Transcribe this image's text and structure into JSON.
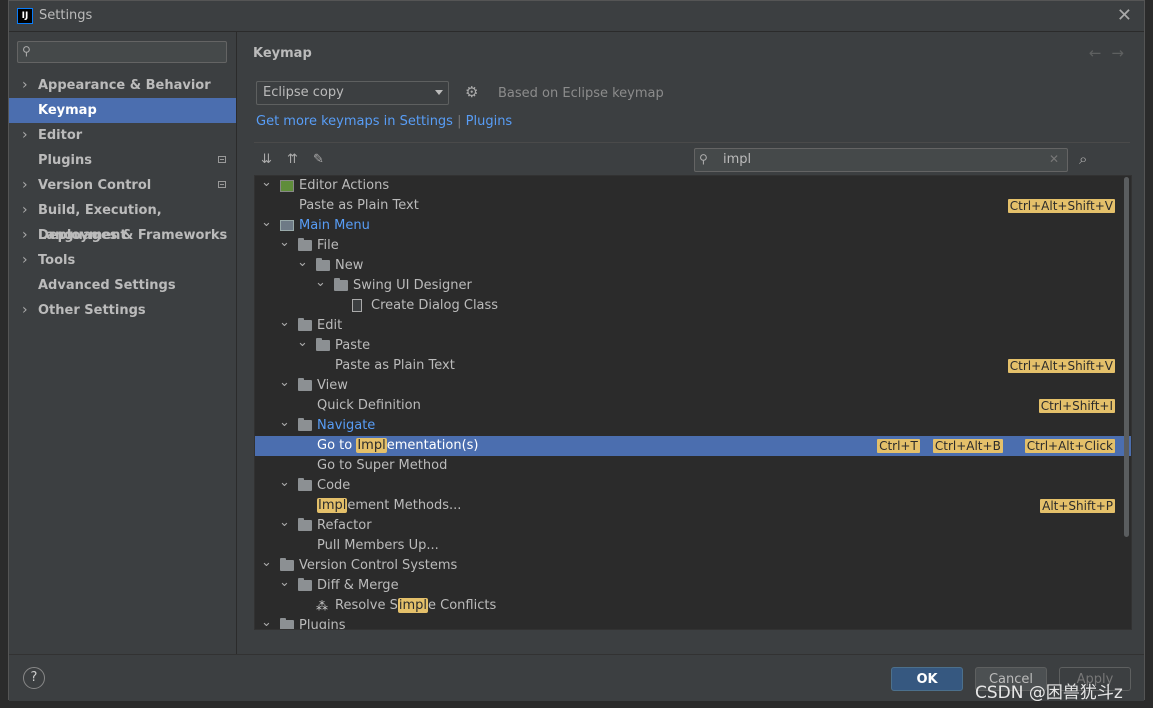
{
  "window": {
    "title": "Settings",
    "app_icon_label": "IJ"
  },
  "sidebar": {
    "search_placeholder": "",
    "items": [
      {
        "label": "Appearance & Behavior",
        "expandable": true,
        "selected": false,
        "badge": false
      },
      {
        "label": "Keymap",
        "expandable": false,
        "selected": true,
        "badge": false
      },
      {
        "label": "Editor",
        "expandable": true,
        "selected": false,
        "badge": false
      },
      {
        "label": "Plugins",
        "expandable": false,
        "selected": false,
        "badge": true
      },
      {
        "label": "Version Control",
        "expandable": true,
        "selected": false,
        "badge": true
      },
      {
        "label": "Build, Execution, Deployment",
        "expandable": true,
        "selected": false,
        "badge": false
      },
      {
        "label": "Languages & Frameworks",
        "expandable": true,
        "selected": false,
        "badge": false
      },
      {
        "label": "Tools",
        "expandable": true,
        "selected": false,
        "badge": false
      },
      {
        "label": "Advanced Settings",
        "expandable": false,
        "selected": false,
        "badge": false
      },
      {
        "label": "Other Settings",
        "expandable": true,
        "selected": false,
        "badge": false
      }
    ]
  },
  "content": {
    "title": "Keymap",
    "keymap_selected": "Eclipse copy",
    "based_on": "Based on Eclipse keymap",
    "link_settings": "Get more keymaps in Settings",
    "link_sep": "|",
    "link_plugins": "Plugins",
    "search_value": "impl"
  },
  "tree": [
    {
      "level": 0,
      "type": "group",
      "icon": "action",
      "label": "Editor Actions",
      "expanded": true,
      "blue": false,
      "sel": false,
      "shortcuts": []
    },
    {
      "level": 1,
      "type": "leaf",
      "icon": "",
      "label": "Paste as Plain Text",
      "blue": false,
      "sel": false,
      "shortcuts": [
        "Ctrl+Alt+Shift+V"
      ]
    },
    {
      "level": 0,
      "type": "group",
      "icon": "menu",
      "label": "Main Menu",
      "expanded": true,
      "blue": true,
      "sel": false,
      "shortcuts": []
    },
    {
      "level": 1,
      "type": "group",
      "icon": "folder",
      "label": "File",
      "expanded": true,
      "blue": false,
      "sel": false,
      "shortcuts": []
    },
    {
      "level": 2,
      "type": "group",
      "icon": "folder",
      "label": "New",
      "expanded": true,
      "blue": false,
      "sel": false,
      "shortcuts": []
    },
    {
      "level": 3,
      "type": "group",
      "icon": "folder",
      "label": "Swing UI Designer",
      "expanded": true,
      "blue": false,
      "sel": false,
      "shortcuts": []
    },
    {
      "level": 4,
      "type": "leaf",
      "icon": "doc",
      "label": "Create Dialog Class",
      "blue": false,
      "sel": false,
      "shortcuts": []
    },
    {
      "level": 1,
      "type": "group",
      "icon": "folder",
      "label": "Edit",
      "expanded": true,
      "blue": false,
      "sel": false,
      "shortcuts": []
    },
    {
      "level": 2,
      "type": "group",
      "icon": "folder",
      "label": "Paste",
      "expanded": true,
      "blue": false,
      "sel": false,
      "shortcuts": []
    },
    {
      "level": 3,
      "type": "leaf",
      "icon": "",
      "label": "Paste as Plain Text",
      "blue": false,
      "sel": false,
      "shortcuts": [
        "Ctrl+Alt+Shift+V"
      ]
    },
    {
      "level": 1,
      "type": "group",
      "icon": "folder",
      "label": "View",
      "expanded": true,
      "blue": false,
      "sel": false,
      "shortcuts": []
    },
    {
      "level": 2,
      "type": "leaf",
      "icon": "",
      "label": "Quick Definition",
      "blue": false,
      "sel": false,
      "shortcuts": [
        "Ctrl+Shift+I"
      ]
    },
    {
      "level": 1,
      "type": "group",
      "icon": "folder",
      "label": "Navigate",
      "expanded": true,
      "blue": true,
      "sel": false,
      "shortcuts": []
    },
    {
      "level": 2,
      "type": "leaf",
      "icon": "",
      "label": "Go to Implementation(s)",
      "pre": "Go to ",
      "hl": "Impl",
      "post": "ementation(s)",
      "blue": false,
      "sel": true,
      "shortcuts": [
        "Ctrl+T",
        "Ctrl+Alt+B",
        "Ctrl+Alt+Click"
      ]
    },
    {
      "level": 2,
      "type": "leaf",
      "icon": "",
      "label": "Go to Super Method",
      "blue": false,
      "sel": false,
      "shortcuts": []
    },
    {
      "level": 1,
      "type": "group",
      "icon": "folder",
      "label": "Code",
      "expanded": true,
      "blue": false,
      "sel": false,
      "shortcuts": []
    },
    {
      "level": 2,
      "type": "leaf",
      "icon": "",
      "label": "Implement Methods...",
      "pre": "",
      "hl": "Impl",
      "post": "ement Methods...",
      "blue": false,
      "sel": false,
      "shortcuts": [
        "Alt+Shift+P"
      ]
    },
    {
      "level": 1,
      "type": "group",
      "icon": "folder",
      "label": "Refactor",
      "expanded": true,
      "blue": false,
      "sel": false,
      "shortcuts": []
    },
    {
      "level": 2,
      "type": "leaf",
      "icon": "",
      "label": "Pull Members Up...",
      "blue": false,
      "sel": false,
      "shortcuts": []
    },
    {
      "level": 0,
      "type": "group",
      "icon": "folder",
      "label": "Version Control Systems",
      "expanded": true,
      "blue": false,
      "sel": false,
      "shortcuts": []
    },
    {
      "level": 1,
      "type": "group",
      "icon": "folder",
      "label": "Diff & Merge",
      "expanded": true,
      "blue": false,
      "sel": false,
      "shortcuts": []
    },
    {
      "level": 2,
      "type": "leaf",
      "icon": "wand",
      "label": "Resolve Simple Conflicts",
      "pre": "Resolve S",
      "hl": "impl",
      "post": "e Conflicts",
      "blue": false,
      "sel": false,
      "shortcuts": []
    },
    {
      "level": 0,
      "type": "group",
      "icon": "folder",
      "label": "Plugins",
      "expanded": true,
      "blue": false,
      "sel": false,
      "shortcuts": []
    }
  ],
  "footer": {
    "help": "?",
    "ok": "OK",
    "cancel": "Cancel",
    "apply": "Apply"
  },
  "watermark": "CSDN @困兽犹斗z"
}
